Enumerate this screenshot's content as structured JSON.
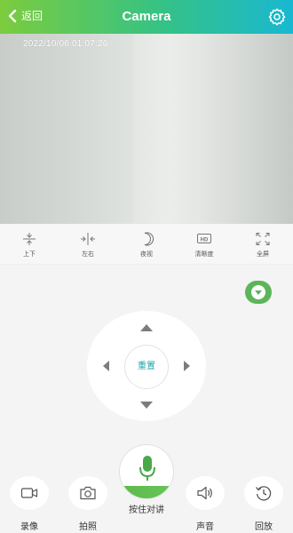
{
  "header": {
    "back_label": "返回",
    "title": "Camera"
  },
  "video": {
    "timestamp": "2022/10/06 01:07:26"
  },
  "controls": {
    "flip_vertical": "上下",
    "flip_horizontal": "左右",
    "night_vision": "夜视",
    "clarity": "清晰度",
    "fullscreen": "全屏",
    "hd_badge": "HD"
  },
  "ptz": {
    "reset_label": "重置"
  },
  "bottom": {
    "record": "录像",
    "photo": "拍照",
    "talk": "按住对讲",
    "sound": "声音",
    "playback": "回放"
  },
  "colors": {
    "header_gradient_start": "#7ccc3e",
    "header_gradient_end": "#19b8d2",
    "accent_green": "#5bb659",
    "reset_text": "#1fa3ad"
  },
  "icons": {
    "back": "chevron-left-icon",
    "settings": "gear-icon",
    "flip_vertical": "flip-vertical-icon",
    "flip_horizontal": "flip-horizontal-icon",
    "night_vision": "moon-icon",
    "clarity": "hd-icon",
    "fullscreen": "fullscreen-icon",
    "record": "video-camera-icon",
    "photo": "camera-icon",
    "talk": "microphone-icon",
    "sound": "speaker-icon",
    "playback": "history-icon"
  }
}
